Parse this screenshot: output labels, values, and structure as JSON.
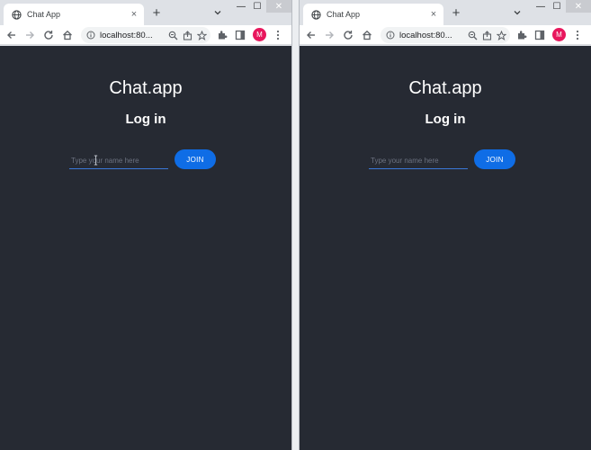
{
  "browser": {
    "tab_title": "Chat App",
    "tab_close": "×",
    "new_tab": "+",
    "url": "localhost:80...",
    "profile_initial": "M",
    "window_min": "—",
    "window_max": "☐",
    "window_close": "✕"
  },
  "app": {
    "title": "Chat.app",
    "heading": "Log in",
    "input_placeholder": "Type your name here",
    "input_value": "",
    "join_label": "JOIN"
  },
  "colors": {
    "page_bg": "#262a33",
    "accent": "#0f6de6",
    "avatar": "#e8175d"
  }
}
